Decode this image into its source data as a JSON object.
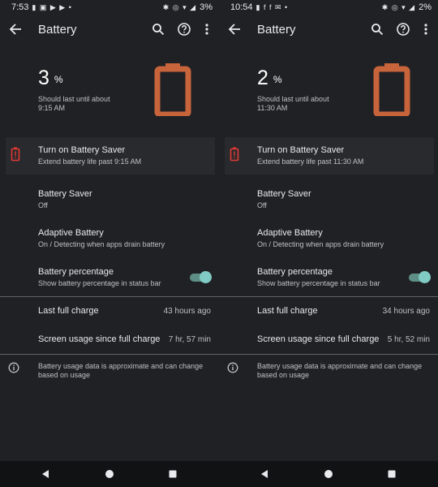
{
  "screens": [
    {
      "status": {
        "time": "7:53",
        "battery_text": "3%"
      },
      "title": "Battery",
      "level": {
        "value": "3",
        "unit": "%"
      },
      "estimate": {
        "line1": "Should last until about",
        "line2": "9:15 AM"
      },
      "saver_card": {
        "title": "Turn on Battery Saver",
        "subtitle": "Extend battery life past 9:15 AM"
      },
      "settings": [
        {
          "title": "Battery Saver",
          "subtitle": "Off"
        },
        {
          "title": "Adaptive Battery",
          "subtitle": "On / Detecting when apps drain battery"
        },
        {
          "title": "Battery percentage",
          "subtitle": "Show battery percentage in status bar"
        }
      ],
      "toggle_on": true,
      "stats": [
        {
          "label": "Last full charge",
          "value": "43 hours ago"
        },
        {
          "label": "Screen usage since full charge",
          "value": "7 hr, 57 min"
        }
      ],
      "footnote": "Battery usage data is approximate and can change based on usage"
    },
    {
      "status": {
        "time": "10:54",
        "battery_text": "2%"
      },
      "title": "Battery",
      "level": {
        "value": "2",
        "unit": "%"
      },
      "estimate": {
        "line1": "Should last until about",
        "line2": "11:30 AM"
      },
      "saver_card": {
        "title": "Turn on Battery Saver",
        "subtitle": "Extend battery life past 11:30 AM"
      },
      "settings": [
        {
          "title": "Battery Saver",
          "subtitle": "Off"
        },
        {
          "title": "Adaptive Battery",
          "subtitle": "On / Detecting when apps drain battery"
        },
        {
          "title": "Battery percentage",
          "subtitle": "Show battery percentage in status bar"
        }
      ],
      "toggle_on": true,
      "stats": [
        {
          "label": "Last full charge",
          "value": "34 hours ago"
        },
        {
          "label": "Screen usage since full charge",
          "value": "5 hr, 52 min"
        }
      ],
      "footnote": "Battery usage data is approximate and can change based on usage"
    }
  ],
  "colors": {
    "battery_accent": "#c8643c",
    "toggle_track": "#5e8f86",
    "toggle_knob": "#80cbc4"
  },
  "icons": [
    "back-arrow-icon",
    "search-icon",
    "help-icon",
    "more-vert-icon",
    "battery-alert-icon",
    "info-icon",
    "nav-back-icon",
    "nav-home-icon",
    "nav-recents-icon"
  ]
}
